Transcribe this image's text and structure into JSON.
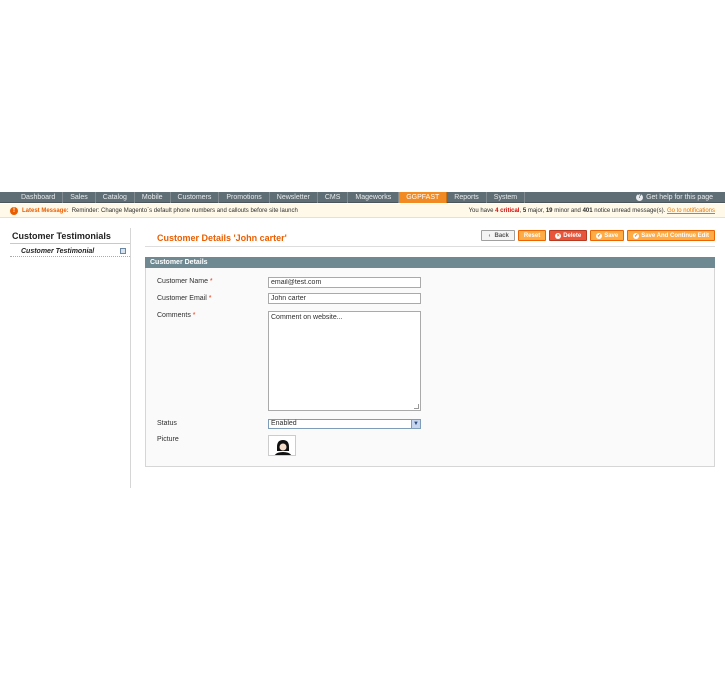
{
  "nav": {
    "items": [
      "Dashboard",
      "Sales",
      "Catalog",
      "Mobile",
      "Customers",
      "Promotions",
      "Newsletter",
      "CMS",
      "Mageworks",
      "GGPFAST",
      "Reports",
      "System"
    ],
    "active_index": 9,
    "help_text": "Get help for this page",
    "help_icon": "help-icon"
  },
  "notice": {
    "label": "Latest Message:",
    "text": "Reminder: Change Magento`s default phone numbers and callouts before site launch",
    "right_prefix": "You have",
    "critical_count": "4",
    "critical_label": "critical",
    "major_count": "5",
    "major_label": "major",
    "minor_count": "19",
    "minor_label": "minor and",
    "notice_count": "401",
    "notice_label": "notice unread message(s).",
    "link": "Go to notifications"
  },
  "sidebar": {
    "title": "Customer Testimonials",
    "items": [
      {
        "label": "Customer Testimonial"
      }
    ]
  },
  "page": {
    "title": "Customer Details 'John carter'"
  },
  "buttons": {
    "back": "Back",
    "reset": "Reset",
    "delete": "Delete",
    "save": "Save",
    "save_continue": "Save And Continue Edit"
  },
  "form": {
    "section_title": "Customer Details",
    "name_label": "Customer Name",
    "name_value": "email@test.com",
    "email_label": "Customer Email",
    "email_value": "John carter",
    "comments_label": "Comments",
    "comments_value": "Comment on website...",
    "status_label": "Status",
    "status_value": "Enabled",
    "picture_label": "Picture",
    "required_mark": "*"
  },
  "colors": {
    "accent": "#eb5e00",
    "nav_bg": "#5f6d74",
    "section_head": "#6f8992"
  }
}
